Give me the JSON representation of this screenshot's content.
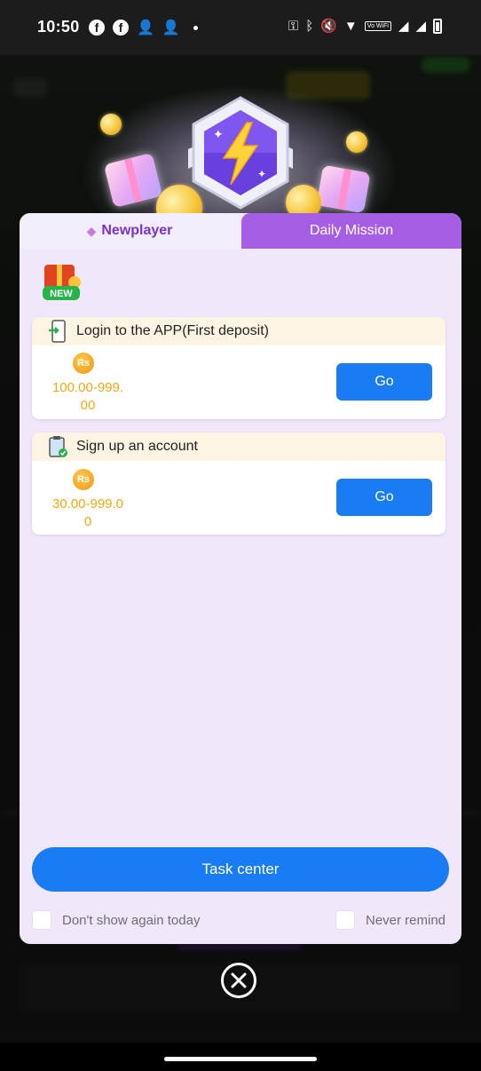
{
  "status_bar": {
    "time": "10:50",
    "left_icons": [
      "facebook-icon",
      "facebook-icon",
      "person-add-icon",
      "person-add-icon",
      "dot-icon"
    ],
    "right_icons": [
      "key-icon",
      "bluetooth-icon",
      "mute-icon",
      "wifi-icon",
      "volte-icon",
      "signal-icon",
      "signal-icon",
      "battery-icon"
    ],
    "volte_text": "Vo WiFi"
  },
  "modal": {
    "tabs": [
      {
        "label": "Newplayer",
        "active": true
      },
      {
        "label": "Daily Mission",
        "active": false
      }
    ],
    "new_badge": "NEW",
    "tasks": [
      {
        "title": "Login to the APP(First deposit)",
        "currency": "Rs",
        "amount_line1": "100.00-999.",
        "amount_line2": "00",
        "button": "Go"
      },
      {
        "title": "Sign up an account",
        "currency": "Rs",
        "amount_line1": "30.00-999.0",
        "amount_line2": "0",
        "button": "Go"
      }
    ],
    "task_center_button": "Task center",
    "dont_show_label": "Don't show again today",
    "never_remind_label": "Never remind"
  },
  "colors": {
    "accent_blue": "#1a7cf5",
    "tab_purple": "#a55ee3",
    "active_tab_text": "#7a33c7",
    "amount_orange": "#f0a81b",
    "modal_bg": "#f1e7fb"
  }
}
